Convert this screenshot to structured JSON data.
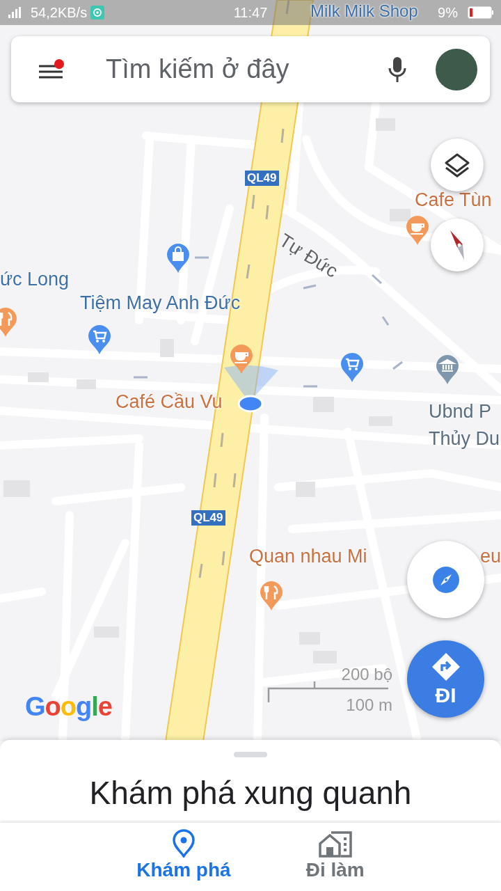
{
  "status_bar": {
    "speed": "54,2KB/s",
    "time": "11:47",
    "battery": "9%"
  },
  "search": {
    "placeholder": "Tìm kiếm ở đây",
    "menu_notification": true
  },
  "map": {
    "labels": [
      {
        "text": "Milk Milk Shop",
        "kind": "business"
      },
      {
        "text": "Cafe Tùn",
        "kind": "food"
      },
      {
        "text": "Tự Đức",
        "kind": "street"
      },
      {
        "text": "ức Long",
        "kind": "business"
      },
      {
        "text": "Tiệm May Anh Đức",
        "kind": "business"
      },
      {
        "text": "Café Cầu Vu",
        "kind": "food"
      },
      {
        "text": "Ubnd P",
        "kind": "civic"
      },
      {
        "text": "Thủy Du",
        "kind": "civic"
      },
      {
        "text": "Quan nhau Mi",
        "kind": "food"
      },
      {
        "text": "eu",
        "kind": "food"
      }
    ],
    "shields": [
      "QL49",
      "QL49"
    ],
    "scale": [
      "200 bộ",
      "100 m"
    ],
    "logo": "Google"
  },
  "directions_button": "ĐI",
  "sheet": {
    "title": "Khám phá xung quanh"
  },
  "tabs": [
    {
      "label": "Khám phá",
      "selected": true
    },
    {
      "label": "Đi làm",
      "selected": false
    }
  ]
}
